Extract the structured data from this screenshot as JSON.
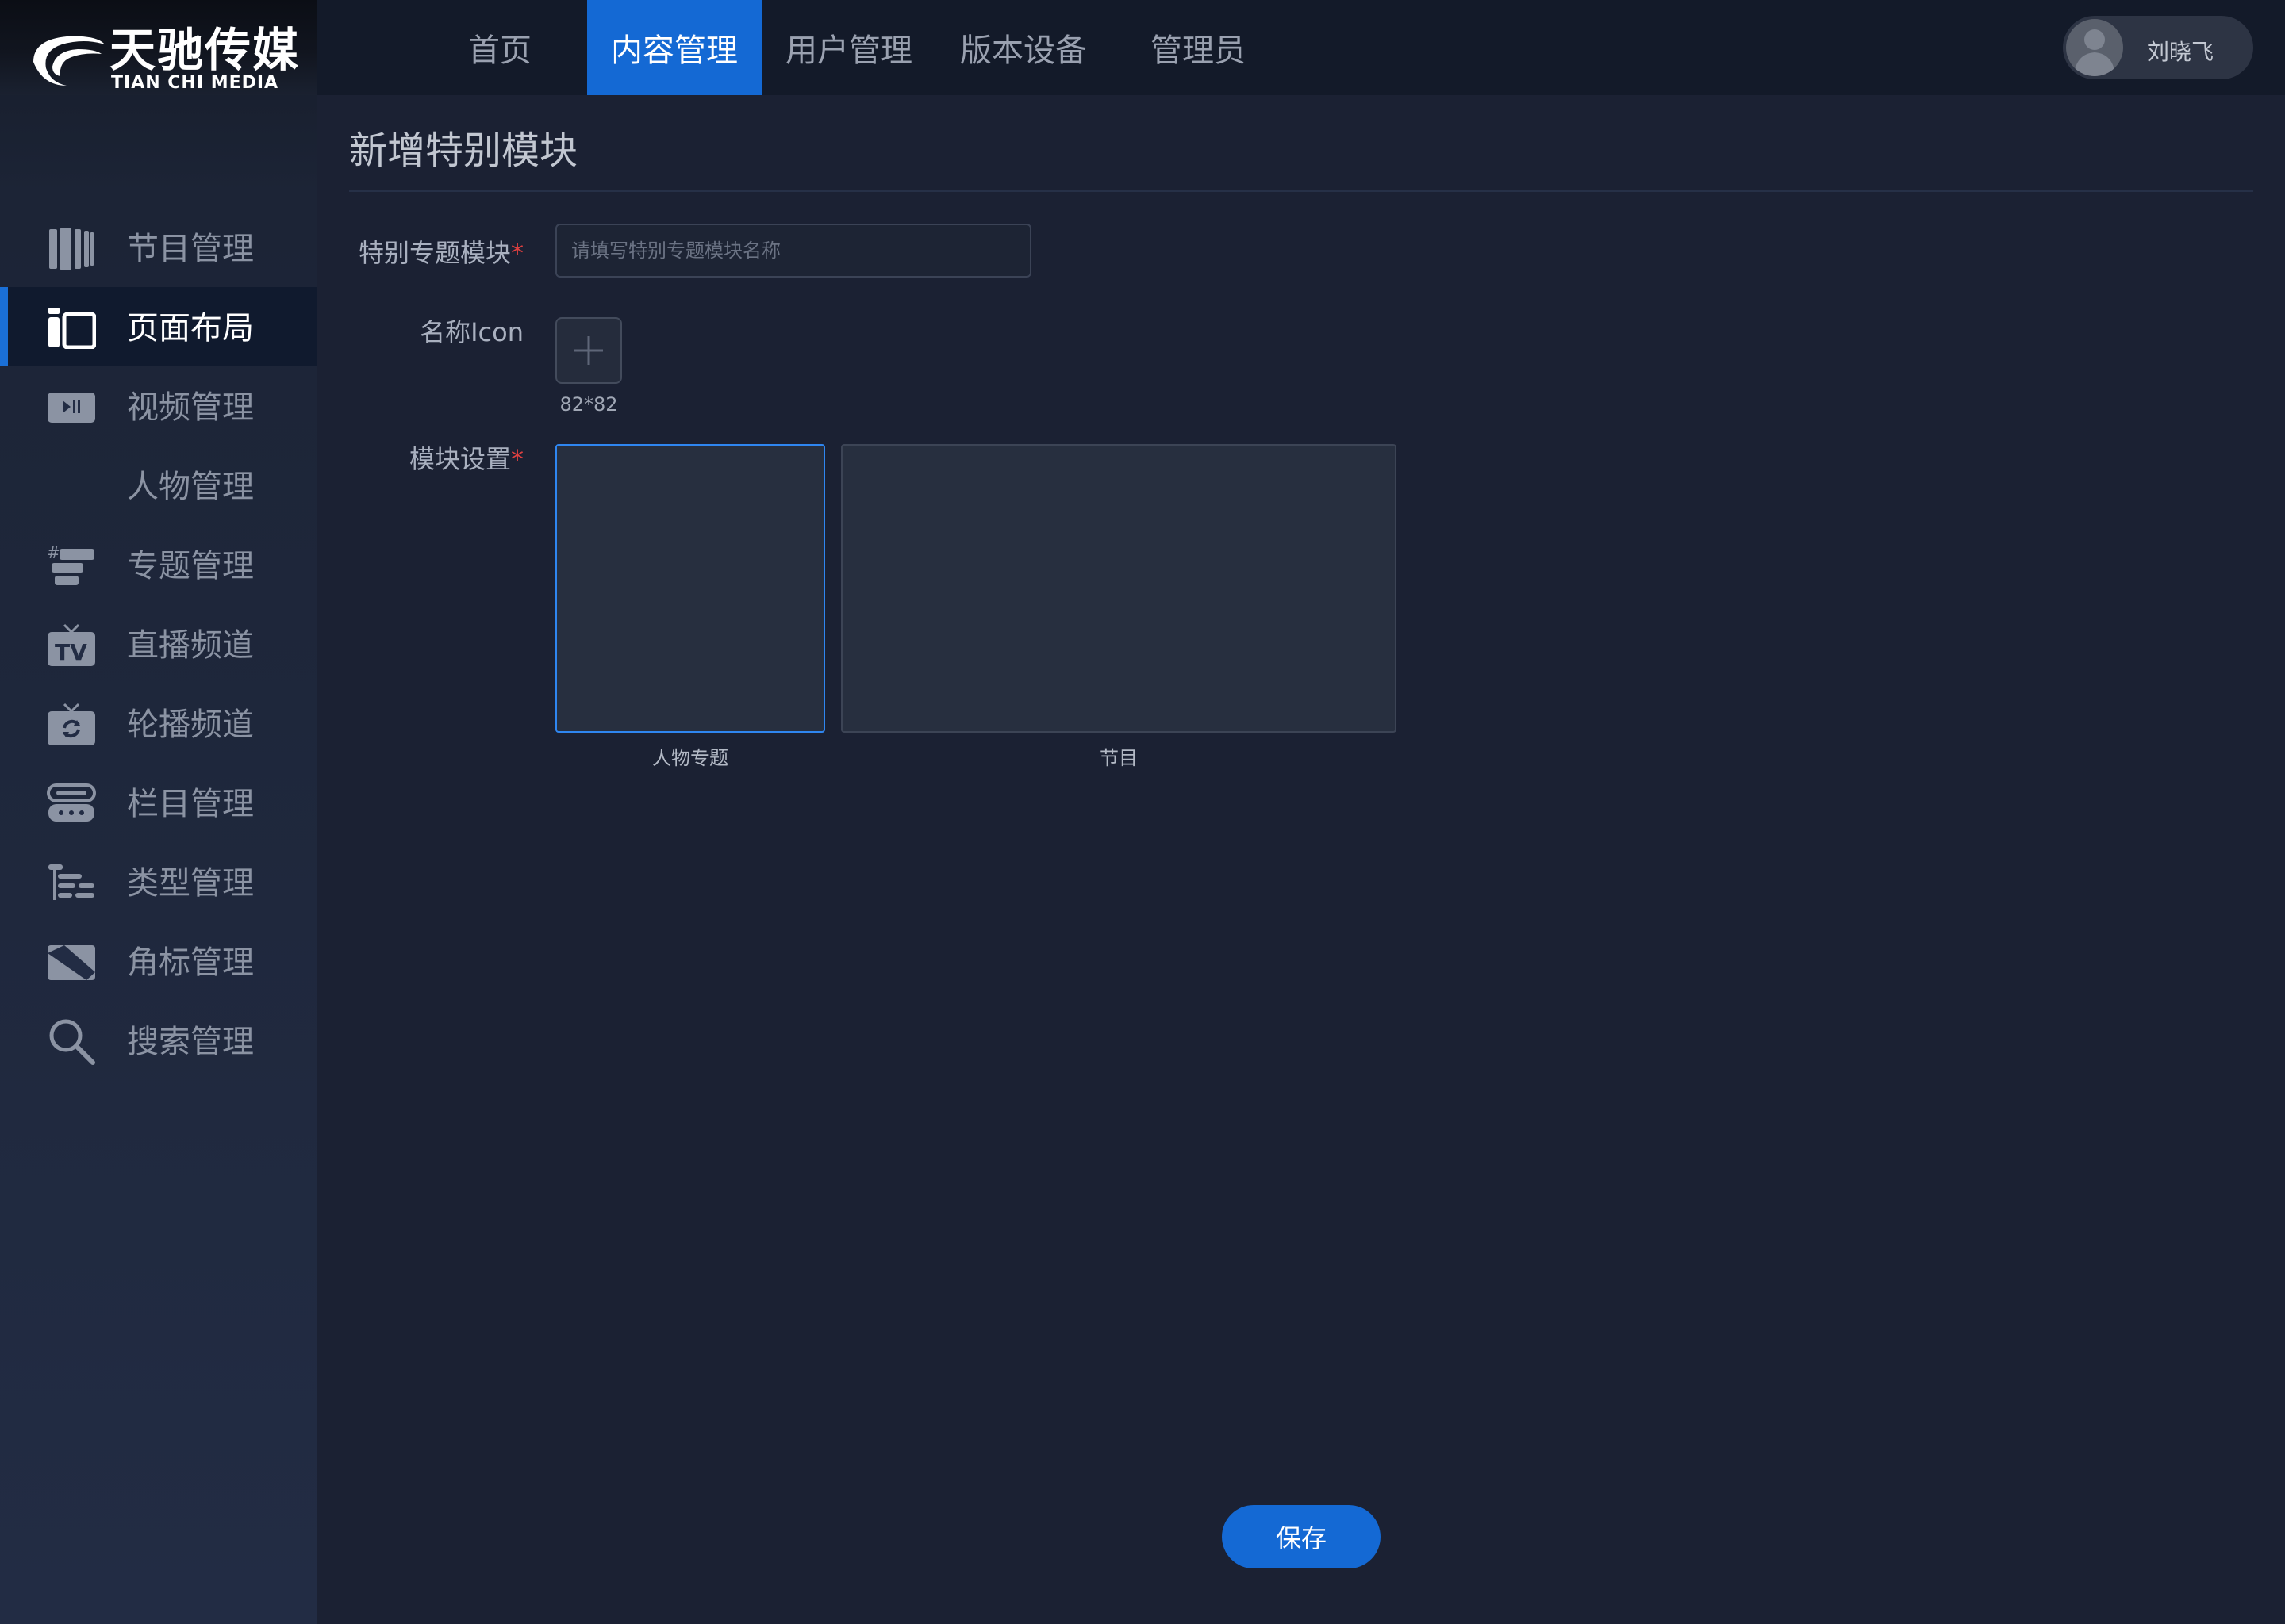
{
  "brand": {
    "name_cn": "天驰传媒",
    "name_en": "TIAN CHI MEDIA"
  },
  "topnav": {
    "tabs": [
      {
        "label": "首页",
        "active": false
      },
      {
        "label": "内容管理",
        "active": true
      },
      {
        "label": "用户管理",
        "active": false
      },
      {
        "label": "版本设备",
        "active": false
      },
      {
        "label": "管理员",
        "active": false
      }
    ],
    "user": {
      "name": "刘晓飞",
      "icon": "user-avatar-icon"
    }
  },
  "sidebar": {
    "items": [
      {
        "label": "节目管理",
        "icon": "program-icon",
        "active": false
      },
      {
        "label": "页面布局",
        "icon": "layout-icon",
        "active": true
      },
      {
        "label": "视频管理",
        "icon": "video-icon",
        "active": false
      },
      {
        "label": "人物管理",
        "icon": "",
        "active": false
      },
      {
        "label": "专题管理",
        "icon": "topic-icon",
        "active": false
      },
      {
        "label": "直播频道",
        "icon": "tv-icon",
        "active": false
      },
      {
        "label": "轮播频道",
        "icon": "carousel-tv-icon",
        "active": false
      },
      {
        "label": "栏目管理",
        "icon": "column-icon",
        "active": false
      },
      {
        "label": "类型管理",
        "icon": "type-tree-icon",
        "active": false
      },
      {
        "label": "角标管理",
        "icon": "corner-badge-icon",
        "active": false
      },
      {
        "label": "搜索管理",
        "icon": "search-icon",
        "active": false
      }
    ]
  },
  "main": {
    "title": "新增特别模块",
    "form": {
      "module_name": {
        "label": "特别专题模块",
        "required_mark": "*",
        "placeholder": "请填写特别专题模块名称",
        "value": ""
      },
      "icon": {
        "label": "名称Icon",
        "size_hint": "82*82"
      },
      "module_settings": {
        "label": "模块设置",
        "required_mark": "*",
        "options": [
          {
            "caption": "人物专题",
            "selected": true
          },
          {
            "caption": "节目",
            "selected": false
          }
        ]
      }
    },
    "save_label": "保存"
  },
  "colors": {
    "accent": "#1469d4",
    "background": "#1b2133",
    "sidebar": "#222c44",
    "required": "#e04040"
  }
}
